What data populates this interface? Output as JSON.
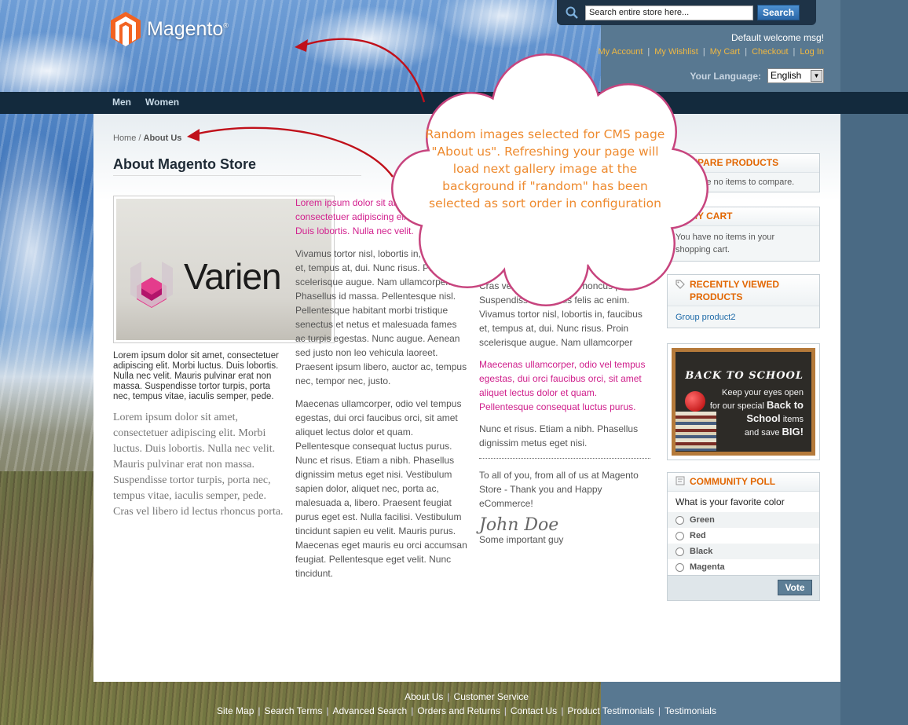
{
  "header": {
    "logo_text": "Magento",
    "logo_reg": "®",
    "welcome": "Default welcome msg!",
    "top_links": [
      "My Account",
      "My Wishlist",
      "My Cart",
      "Checkout",
      "Log In"
    ],
    "language_label": "Your Language:",
    "language_value": "English"
  },
  "search": {
    "placeholder": "Search entire store here...",
    "button": "Search"
  },
  "nav": [
    "Men",
    "Women"
  ],
  "breadcrumb": {
    "home": "Home",
    "sep": " / ",
    "current": "About Us"
  },
  "page_title": "About Magento Store",
  "col1": {
    "photo_word": "Varien",
    "small": "Lorem ipsum dolor sit amet, consectetuer adipiscing elit. Morbi luctus. Duis lobortis. Nulla nec velit. Mauris pulvinar erat non massa. Suspendisse tortor turpis, porta nec, tempus vitae, iaculis semper, pede.",
    "serif": "Lorem ipsum dolor sit amet, consectetuer adipiscing elit. Morbi luctus. Duis lobortis. Nulla nec velit. Mauris pulvinar erat non massa. Suspendisse tortor turpis, porta nec, tempus vitae, iaculis semper, pede. Cras vel libero id lectus rhoncus porta."
  },
  "col2": {
    "p1_magenta": "Lorem ipsum dolor sit amet, consectetuer adipiscing elit. Morbi luctus. Duis lobortis. Nulla nec velit.",
    "p2": "Vivamus tortor nisl, lobortis in, faucibus et, tempus at, dui. Nunc risus. Proin scelerisque augue. Nam ullamcorper. Phasellus id massa. Pellentesque nisl. Pellentesque habitant morbi tristique senectus et netus et malesuada fames ac turpis egestas. Nunc augue. Aenean sed justo non leo vehicula laoreet. Praesent ipsum libero, auctor ac, tempus nec, tempor nec, justo.",
    "p3": "Maecenas ullamcorper, odio vel tempus egestas, dui orci faucibus orci, sit amet aliquet lectus dolor et quam. Pellentesque consequat luctus purus. Nunc et risus. Etiam a nibh. Phasellus dignissim metus eget nisi. Vestibulum sapien dolor, aliquet nec, porta ac, malesuada a, libero. Praesent feugiat purus eget est. Nulla facilisi. Vestibulum tincidunt sapien eu velit. Mauris purus. Maecenas eget mauris eu orci accumsan feugiat. Pellentesque eget velit. Nunc tincidunt."
  },
  "col3": {
    "p1": "Cras vel libero id lectus rhoncus porta. Suspendisse convallis felis ac enim. Vivamus tortor nisl, lobortis in, faucibus et, tempus at, dui. Nunc risus. Proin scelerisque augue. Nam ullamcorper",
    "p2_magenta": "Maecenas ullamcorper, odio vel tempus egestas, dui orci faucibus orci, sit amet aliquet lectus dolor et quam. Pellentesque consequat luctus purus.",
    "p3": "Nunc et risus. Etiam a nibh. Phasellus dignissim metus eget nisi.",
    "p4": "To all of you, from all of us at Magento Store - Thank you and Happy eCommerce!",
    "signature": "John Doe",
    "role": "Some important guy"
  },
  "sidebar": {
    "compare": {
      "title": "COMPARE PRODUCTS",
      "body": "You have no items to compare."
    },
    "cart": {
      "title": "MY CART",
      "body": "You have no items in your shopping cart."
    },
    "recent": {
      "title": "RECENTLY VIEWED PRODUCTS",
      "item": "Group product2"
    },
    "promo": {
      "title": "BACK TO SCHOOL",
      "line1": "Keep your eyes open",
      "line2": "for our special",
      "bold1": "Back to School",
      "line3": "items",
      "line4": "and save",
      "bold2": "BIG!"
    },
    "poll": {
      "title": "COMMUNITY POLL",
      "question": "What is your favorite color",
      "options": [
        "Green",
        "Red",
        "Black",
        "Magenta"
      ],
      "vote": "Vote"
    }
  },
  "footer": {
    "row1": [
      "About Us",
      "Customer Service"
    ],
    "row2": [
      "Site Map",
      "Search Terms",
      "Advanced Search",
      "Orders and Returns",
      "Contact Us",
      "Product Testimonials",
      "Testimonials"
    ]
  },
  "callout": "Random images selected for CMS page \"About us\". Refreshing your page will load next gallery image at the background if \"random\" has been selected as sort order in configuration",
  "colors": {
    "accent_orange": "#e26703",
    "link_yellow": "#f0b842",
    "magenta": "#d2218e",
    "nav_dark": "#132a3d",
    "callout_text": "#ee8a2e",
    "callout_border": "#c7447e"
  }
}
